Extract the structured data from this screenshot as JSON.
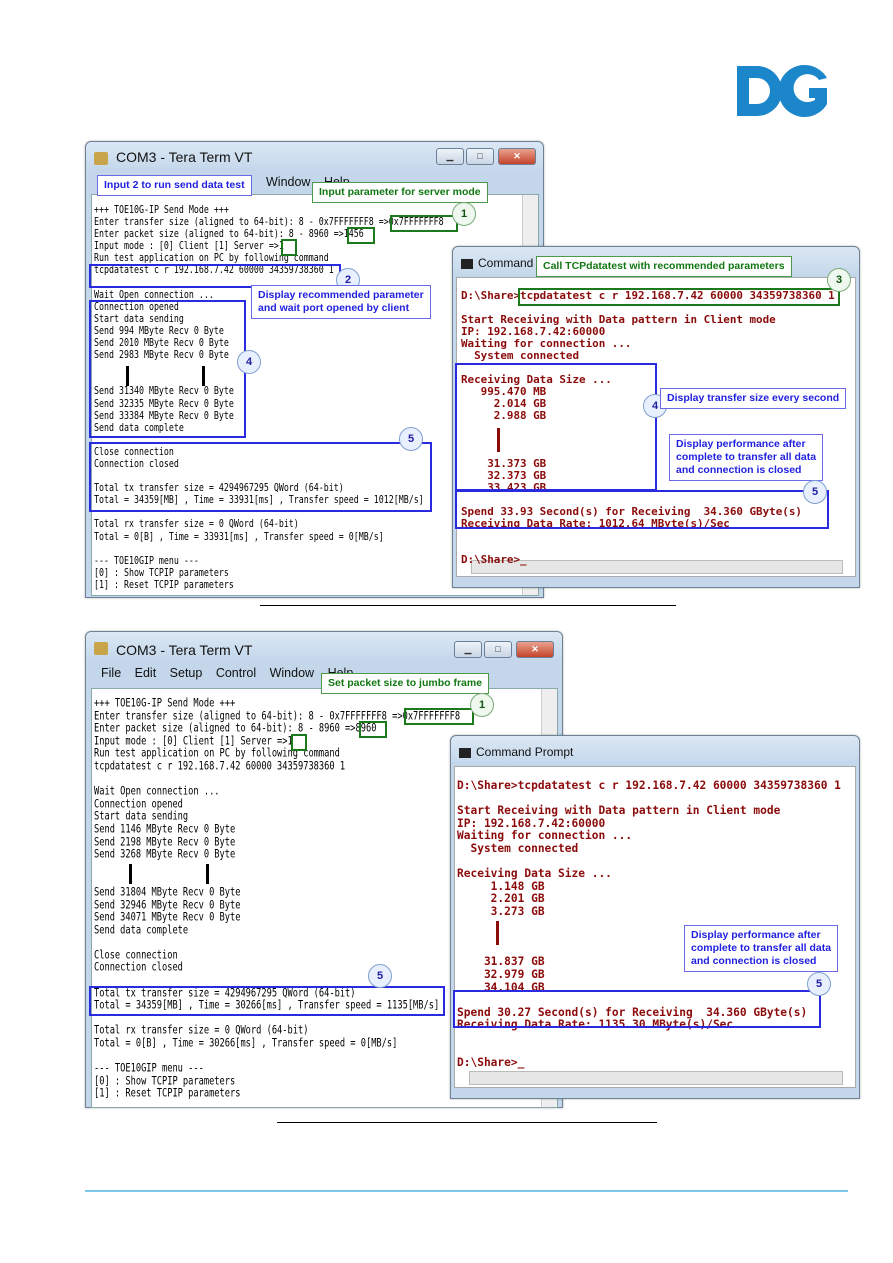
{
  "logo": {
    "text": "DG",
    "color": "#1b86c9"
  },
  "figure1": {
    "teraterm": {
      "title": "COM3 - Tera Term VT",
      "menu_partial": [
        "Window",
        "Help"
      ],
      "lines": [
        "+++ TOE10G-IP Send Mode +++",
        "Enter transfer size (aligned to 64-bit): 8 - 0x7FFFFFFF8 =>0x7FFFFFFF8",
        "Enter packet size (aligned to 64-bit): 8 - 8960 =>1456",
        "Input mode : [0] Client [1] Server =>1",
        "Run test application on PC by following command",
        "tcpdatatest c r 192.168.7.42 60000 34359738360 1",
        "",
        "Wait Open connection ...",
        "Connection opened",
        "Start data sending",
        "Send 994 MByte Recv 0 Byte",
        "Send 2010 MByte Recv 0 Byte",
        "Send 2983 MByte Recv 0 Byte",
        "",
        "",
        "Send 31340 MByte Recv 0 Byte",
        "Send 32335 MByte Recv 0 Byte",
        "Send 33384 MByte Recv 0 Byte",
        "Send data complete",
        "",
        "Close connection",
        "Connection closed",
        "",
        "Total tx transfer size = 4294967295 QWord (64-bit)",
        "Total = 34359[MB] , Time = 33931[ms] , Transfer speed = 1012[MB/s]",
        "",
        "Total rx transfer size = 0 QWord (64-bit)",
        "Total = 0[B] , Time = 33931[ms] , Transfer speed = 0[MB/s]",
        "",
        "--- TOE10GIP menu ---",
        "[0] : Show TCPIP parameters",
        "[1] : Reset TCPIP parameters"
      ]
    },
    "cmd": {
      "title": "Command Prompt",
      "lines": [
        "D:\\Share>tcpdatatest c r 192.168.7.42 60000 34359738360 1",
        "",
        "Start Receiving with Data pattern in Client mode",
        "IP: 192.168.7.42:60000",
        "Waiting for connection ...",
        "  System connected",
        "",
        "Receiving Data Size ...",
        "   995.470 MB",
        "     2.014 GB",
        "     2.988 GB",
        "",
        "",
        "",
        "    31.373 GB",
        "    32.373 GB",
        "    33.423 GB",
        "",
        "Spend 33.93 Second(s) for Receiving  34.360 GByte(s)",
        "Receiving Data Rate: 1012.64 MByte(s)/Sec",
        "",
        "",
        "D:\\Share>_"
      ]
    },
    "notes": {
      "input2": "Input 2 to run send data test",
      "server": "Input parameter for server mode",
      "recommended": [
        "Display recommended parameter",
        "and wait port opened by client"
      ],
      "call": "Call TCPdatatest with recommended parameters",
      "every_second": "Display transfer size every second",
      "performance": [
        "Display performance after",
        "complete to transfer all data",
        "and connection is closed"
      ]
    },
    "markers": [
      "1",
      "2",
      "3",
      "4",
      "4",
      "5",
      "5"
    ]
  },
  "figure2": {
    "teraterm": {
      "title": "COM3 - Tera Term VT",
      "menu": [
        "File",
        "Edit",
        "Setup",
        "Control",
        "Window",
        "Help"
      ],
      "lines": [
        "+++ TOE10G-IP Send Mode +++",
        "Enter transfer size (aligned to 64-bit): 8 - 0x7FFFFFFF8 =>0x7FFFFFFF8",
        "Enter packet size (aligned to 64-bit): 8 - 8960 =>8960",
        "Input mode : [0] Client [1] Server =>1",
        "Run test application on PC by following command",
        "tcpdatatest c r 192.168.7.42 60000 34359738360 1",
        "",
        "Wait Open connection ...",
        "Connection opened",
        "Start data sending",
        "Send 1146 MByte Recv 0 Byte",
        "Send 2198 MByte Recv 0 Byte",
        "Send 3268 MByte Recv 0 Byte",
        "",
        "",
        "Send 31804 MByte Recv 0 Byte",
        "Send 32946 MByte Recv 0 Byte",
        "Send 34071 MByte Recv 0 Byte",
        "Send data complete",
        "",
        "Close connection",
        "Connection closed",
        "",
        "Total tx transfer size = 4294967295 QWord (64-bit)",
        "Total = 34359[MB] , Time = 30266[ms] , Transfer speed = 1135[MB/s]",
        "",
        "Total rx transfer size = 0 QWord (64-bit)",
        "Total = 0[B] , Time = 30266[ms] , Transfer speed = 0[MB/s]",
        "",
        "--- TOE10GIP menu ---",
        "[0] : Show TCPIP parameters",
        "[1] : Reset TCPIP parameters"
      ]
    },
    "cmd": {
      "title": "Command Prompt",
      "lines": [
        "D:\\Share>tcpdatatest c r 192.168.7.42 60000 34359738360 1",
        "",
        "Start Receiving with Data pattern in Client mode",
        "IP: 192.168.7.42:60000",
        "Waiting for connection ...",
        "  System connected",
        "",
        "Receiving Data Size ...",
        "     1.148 GB",
        "     2.201 GB",
        "     3.273 GB",
        "",
        "",
        "",
        "    31.837 GB",
        "    32.979 GB",
        "    34.104 GB",
        "",
        "Spend 30.27 Second(s) for Receiving  34.360 GByte(s)",
        "Receiving Data Rate: 1135.30 MByte(s)/Sec",
        "",
        "",
        "D:\\Share>_"
      ]
    },
    "notes": {
      "jumbo": "Set packet size to jumbo frame",
      "performance": [
        "Display performance after",
        "complete to transfer all data",
        "and connection is closed"
      ]
    },
    "markers": [
      "1",
      "5",
      "5"
    ]
  },
  "colors": {
    "callout_blue": "#2a2ae0",
    "callout_green": "#1c7a1c",
    "cmd_text": "#8b0a0a",
    "footer_rule": "#7fc8ea"
  }
}
